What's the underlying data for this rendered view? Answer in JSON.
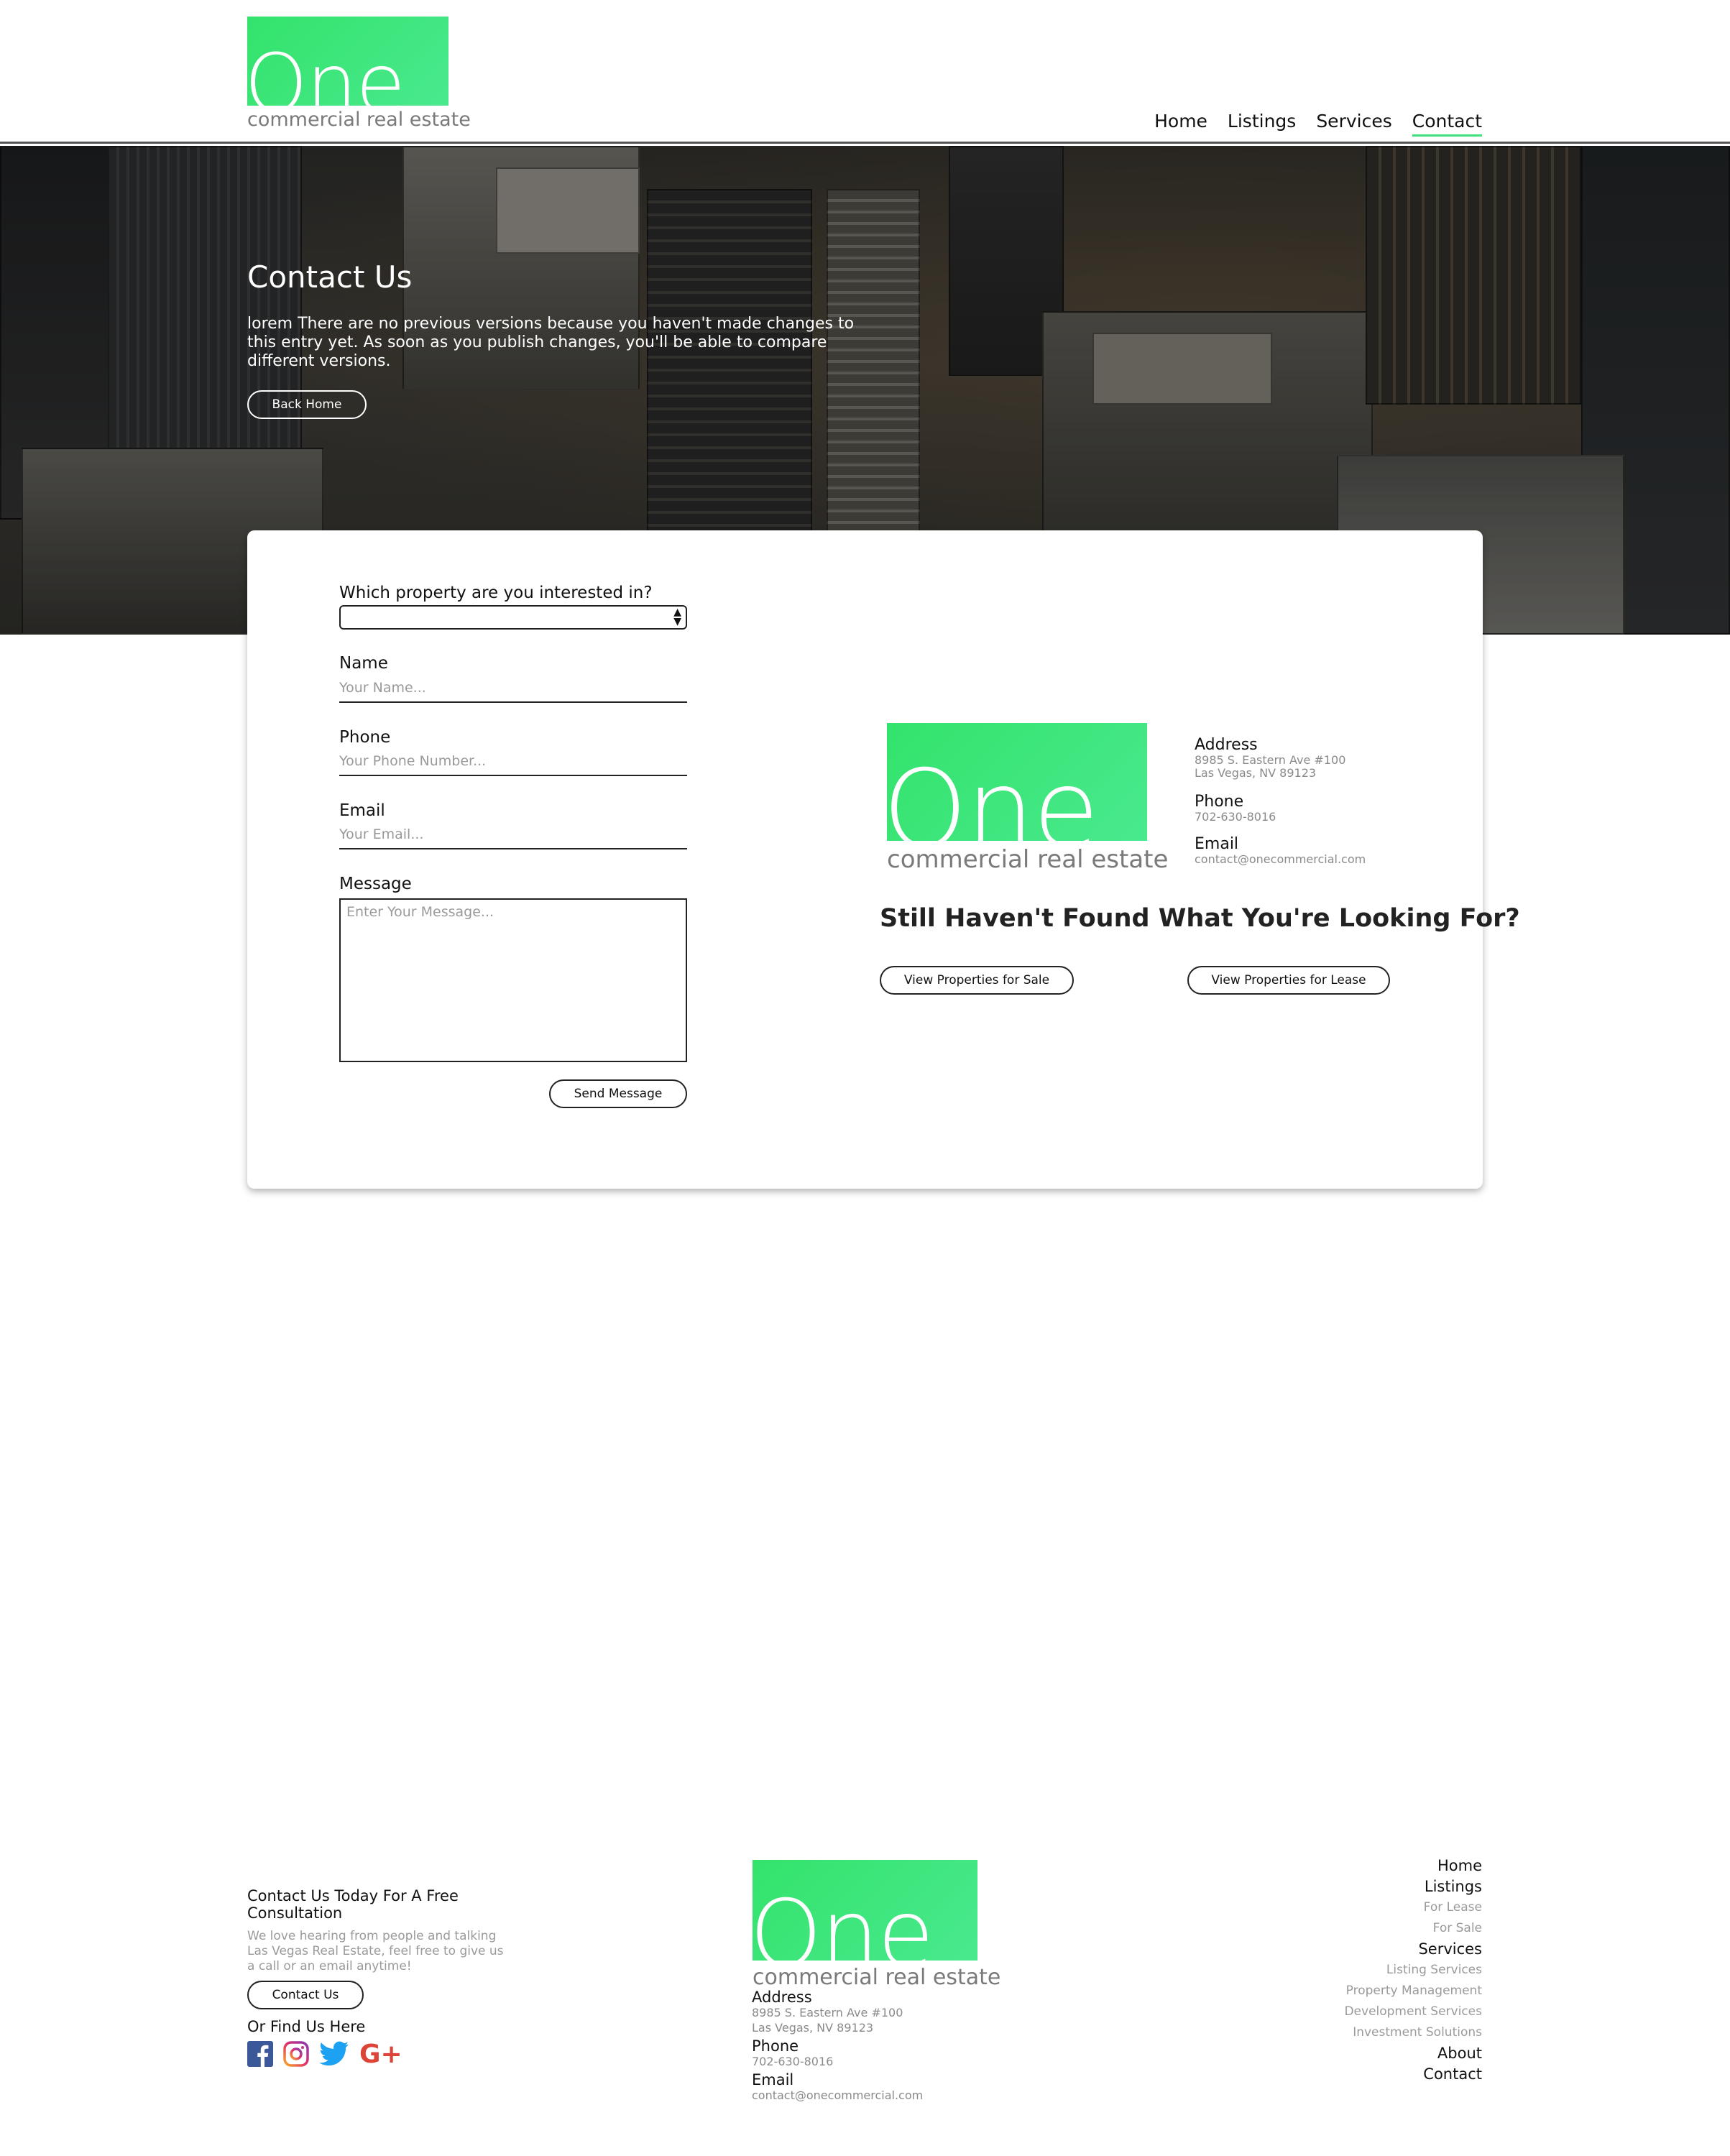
{
  "logo": {
    "word": "One",
    "tagline": "commercial real estate"
  },
  "nav": [
    {
      "label": "Home"
    },
    {
      "label": "Listings"
    },
    {
      "label": "Services"
    },
    {
      "label": "Contact",
      "active": true
    }
  ],
  "hero": {
    "title": "Contact Us",
    "text": "lorem There are no previous versions because you haven't made changes to this entry yet. As soon as you publish changes, you'll be able to compare different versions.",
    "button": "Back Home"
  },
  "form": {
    "property_label": "Which property are you interested in?",
    "property_value": "",
    "name_label": "Name",
    "name_placeholder": "Your Name...",
    "phone_label": "Phone",
    "phone_placeholder": "Your Phone Number...",
    "email_label": "Email",
    "email_placeholder": "Your Email...",
    "message_label": "Message",
    "message_placeholder": "Enter Your Message...",
    "submit": "Send Message"
  },
  "contact": {
    "address_label": "Address",
    "address_line1": "8985 S. Eastern Ave #100",
    "address_line2": "Las Vegas, NV 89123",
    "phone_label": "Phone",
    "phone": "702-630-8016",
    "email_label": "Email",
    "email": "contact@onecommercial.com"
  },
  "cta": {
    "heading": "Still Haven't Found What You're Looking For?",
    "sale_button": "View Properties for Sale",
    "lease_button": "View Properties for Lease"
  },
  "footer": {
    "heading": "Contact Us Today For A Free Consultation",
    "text": "We love hearing from people and talking Las Vegas Real Estate, feel free to give us a call or an email anytime!",
    "button": "Contact Us",
    "find_us": "Or Find Us Here",
    "socials": [
      "facebook-icon",
      "instagram-icon",
      "twitter-icon",
      "google-plus-icon"
    ],
    "menu": {
      "home": "Home",
      "listings": "Listings",
      "for_lease": "For Lease",
      "for_sale": "For Sale",
      "services": "Services",
      "listing_services": "Listing Services",
      "property_management": "Property Management",
      "development_services": "Development Services",
      "investment_solutions": "Investment Solutions",
      "about": "About",
      "contact": "Contact"
    }
  },
  "colors": {
    "brand_green": "#3ee27a",
    "text_dark": "#111111",
    "text_muted": "#9a9a9a"
  }
}
